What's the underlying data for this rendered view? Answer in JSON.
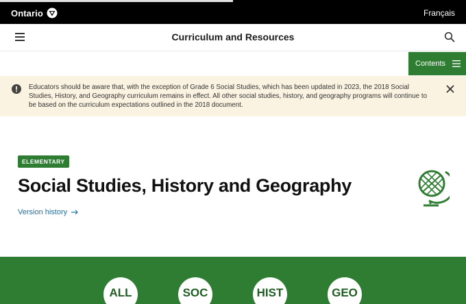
{
  "topbar": {
    "logo_text": "Ontario",
    "language_link": "Français"
  },
  "subheader": {
    "title": "Curriculum and Resources"
  },
  "contents_button": {
    "label": "Contents"
  },
  "alert": {
    "message": "Educators should be aware that, with the exception of Grade 6 Social Studies, which has been updated in 2023, the 2018 Social Studies, History, and Geography curriculum remains in effect. All other social studies, history, and geography programs will continue to be based on the curriculum expectations outlined in the 2018 document."
  },
  "hero": {
    "badge": "ELEMENTARY",
    "title": "Social Studies, History and Geography",
    "version_link": "Version history"
  },
  "strands": [
    {
      "label": "ALL"
    },
    {
      "label": "SOC"
    },
    {
      "label": "HIST"
    },
    {
      "label": "GEO"
    }
  ],
  "colors": {
    "brand_green": "#2e7d32",
    "alert_background": "#fbf3e1",
    "link_blue": "#1c6ea4"
  }
}
